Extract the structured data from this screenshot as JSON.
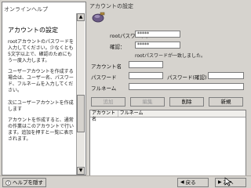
{
  "help": {
    "title": "オンラインヘルプ",
    "heading": "アカウントの設定",
    "paragraph1": "rootアカウントのパスワードを入力してください。少なくとも5文字以上で、確認のためにもう一度入力します。",
    "paragraph2": "ユーザーアカウントを作成する場合は、ユーザー名、パスワード、フルネームを入力してください。",
    "subheading": "次にユーザーアカウントを作成します",
    "paragraph3": "アカウントを作成すると、通常の作業はこのアカウントで行います。追加を押すと一覧に表示されます。",
    "scroll_up": "▲",
    "scroll_down": "▼"
  },
  "section_title": "アカウントの設定",
  "root": {
    "password_label": "rootパスワード：",
    "password_value": "*****",
    "confirm_label": "確認：",
    "confirm_value": "*****",
    "match_note": "rootパスワードが一致しました。"
  },
  "user": {
    "account_label": "アカウント名",
    "password_label": "パスワード",
    "confirm_label": "パスワード(確認)",
    "fullname_label": "フルネーム"
  },
  "buttons": {
    "add": "追加",
    "edit": "編集",
    "delete": "削除",
    "new": "新規"
  },
  "list": {
    "col_account": "アカウント名",
    "col_fullname": "フルネーム"
  },
  "bottom": {
    "hide_help": "ヘルプを隠す",
    "back": "戻る",
    "next": "次へ"
  }
}
